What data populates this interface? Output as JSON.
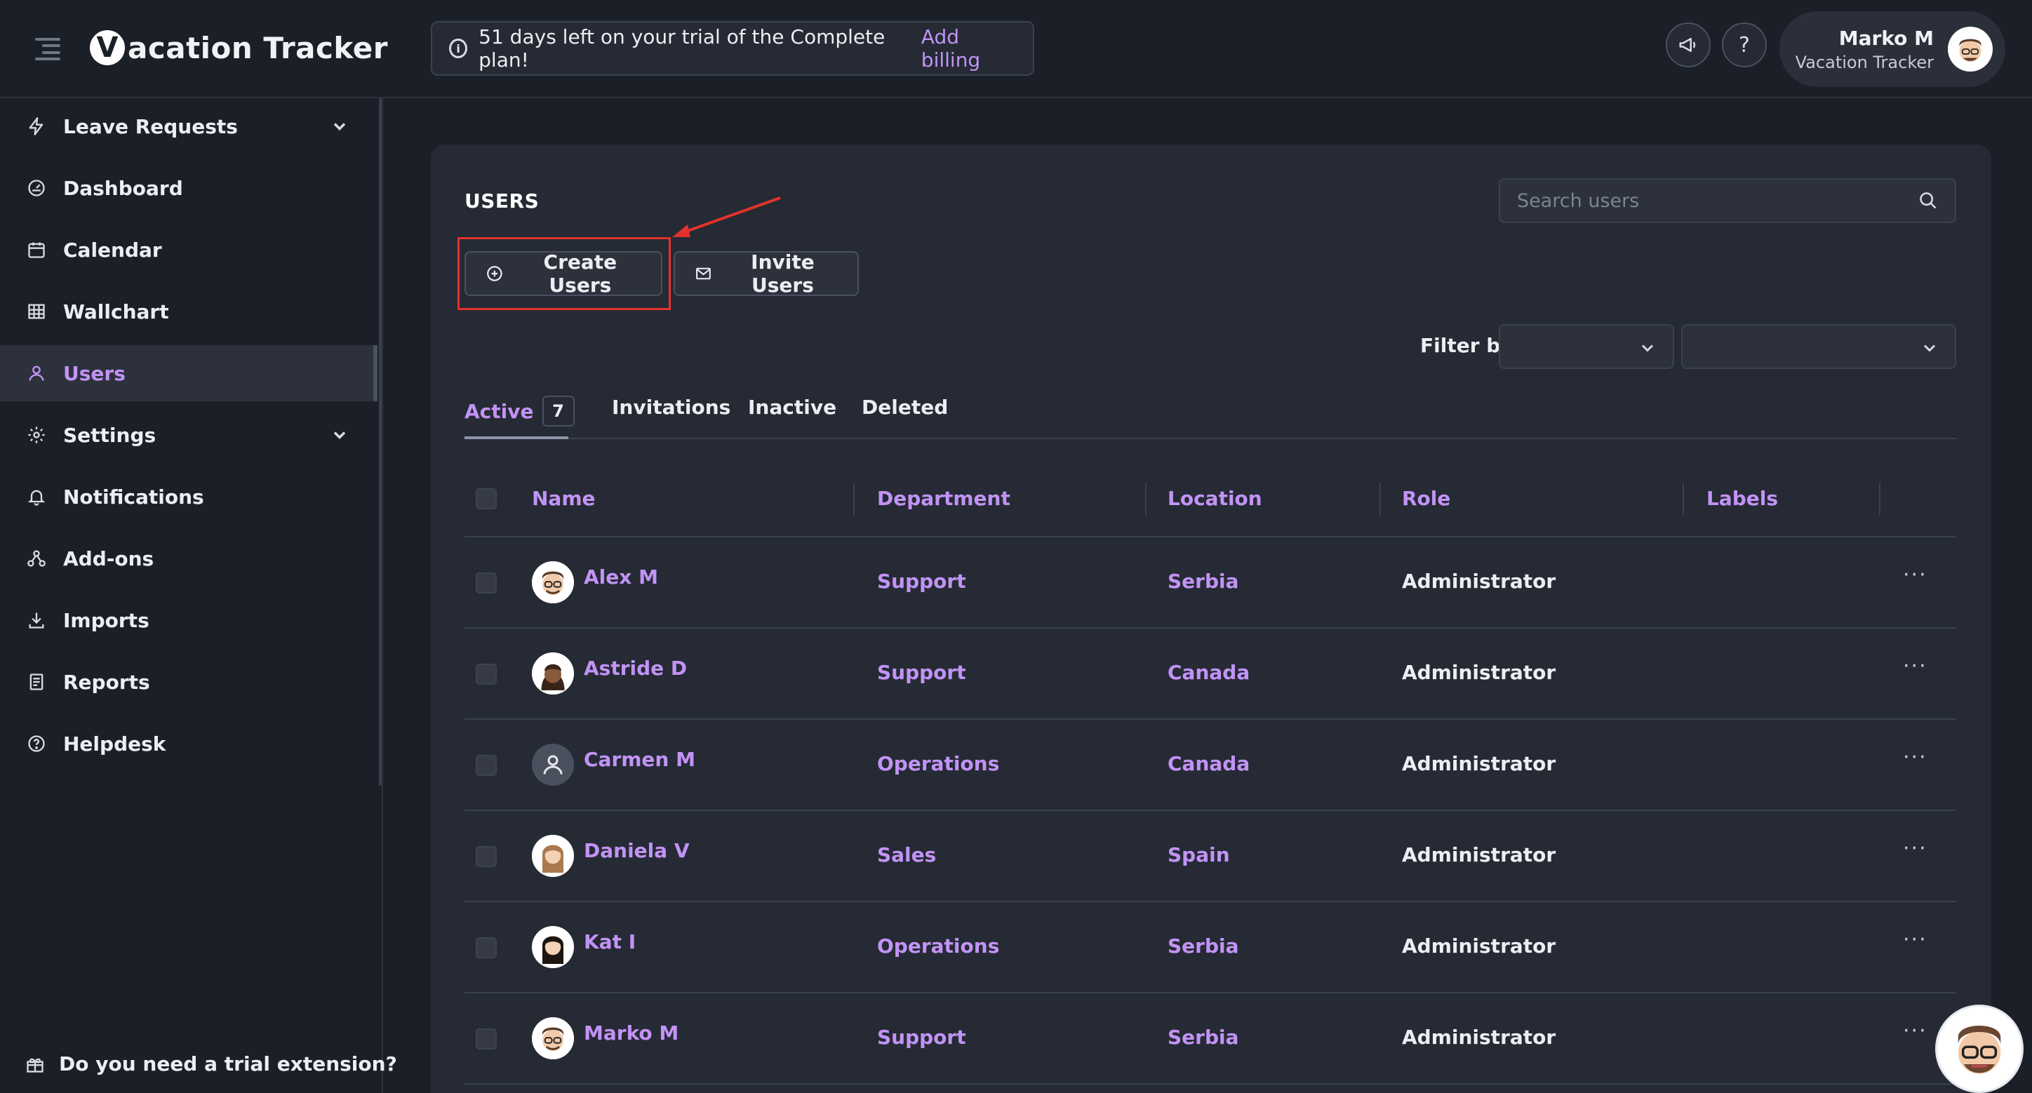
{
  "app": {
    "logo_mark": "V",
    "logo_text": "acation Tracker"
  },
  "banner": {
    "text": "51 days left on your trial of the Complete plan!",
    "link": "Add billing"
  },
  "header": {
    "help_icon_glyph": "?",
    "user_name": "Marko M",
    "user_org": "Vacation Tracker"
  },
  "sidebar": {
    "items": [
      {
        "label": "Leave Requests",
        "icon": "lightning-icon",
        "has_chevron": true
      },
      {
        "label": "Dashboard",
        "icon": "gauge-icon"
      },
      {
        "label": "Calendar",
        "icon": "calendar-icon"
      },
      {
        "label": "Wallchart",
        "icon": "grid-icon"
      },
      {
        "label": "Users",
        "icon": "user-icon",
        "active": true
      },
      {
        "label": "Settings",
        "icon": "gear-icon",
        "has_chevron": true
      },
      {
        "label": "Notifications",
        "icon": "bell-icon"
      },
      {
        "label": "Add-ons",
        "icon": "addons-icon"
      },
      {
        "label": "Imports",
        "icon": "import-icon"
      },
      {
        "label": "Reports",
        "icon": "report-icon"
      },
      {
        "label": "Helpdesk",
        "icon": "help-circle-icon"
      }
    ],
    "trial_extension": "Do you need a trial extension?"
  },
  "users_page": {
    "title": "USERS",
    "search_placeholder": "Search users",
    "create_button": "Create Users",
    "invite_button": "Invite Users",
    "filter_label": "Filter by",
    "tabs": [
      {
        "label": "Active",
        "count": "7",
        "active": true
      },
      {
        "label": "Invitations"
      },
      {
        "label": "Inactive"
      },
      {
        "label": "Deleted"
      }
    ],
    "columns": [
      "Name",
      "Department",
      "Location",
      "Role",
      "Labels"
    ],
    "more_glyph": "···",
    "rows": [
      {
        "name": "Alex M",
        "department": "Support",
        "location": "Serbia",
        "role": "Administrator",
        "avatar": "avatar-glasses"
      },
      {
        "name": "Astride D",
        "department": "Support",
        "location": "Canada",
        "role": "Administrator",
        "avatar": "avatar-dark-hair"
      },
      {
        "name": "Carmen M",
        "department": "Operations",
        "location": "Canada",
        "role": "Administrator",
        "avatar": "avatar-placeholder"
      },
      {
        "name": "Daniela V",
        "department": "Sales",
        "location": "Spain",
        "role": "Administrator",
        "avatar": "avatar-long-hair"
      },
      {
        "name": "Kat I",
        "department": "Operations",
        "location": "Serbia",
        "role": "Administrator",
        "avatar": "avatar-dark-long-hair"
      },
      {
        "name": "Marko M",
        "department": "Support",
        "location": "Serbia",
        "role": "Administrator",
        "avatar": "avatar-glasses"
      }
    ]
  },
  "colors": {
    "accent": "#c293f5",
    "background": "#1b1f27",
    "card": "#252a34",
    "highlight": "#e3322b"
  }
}
